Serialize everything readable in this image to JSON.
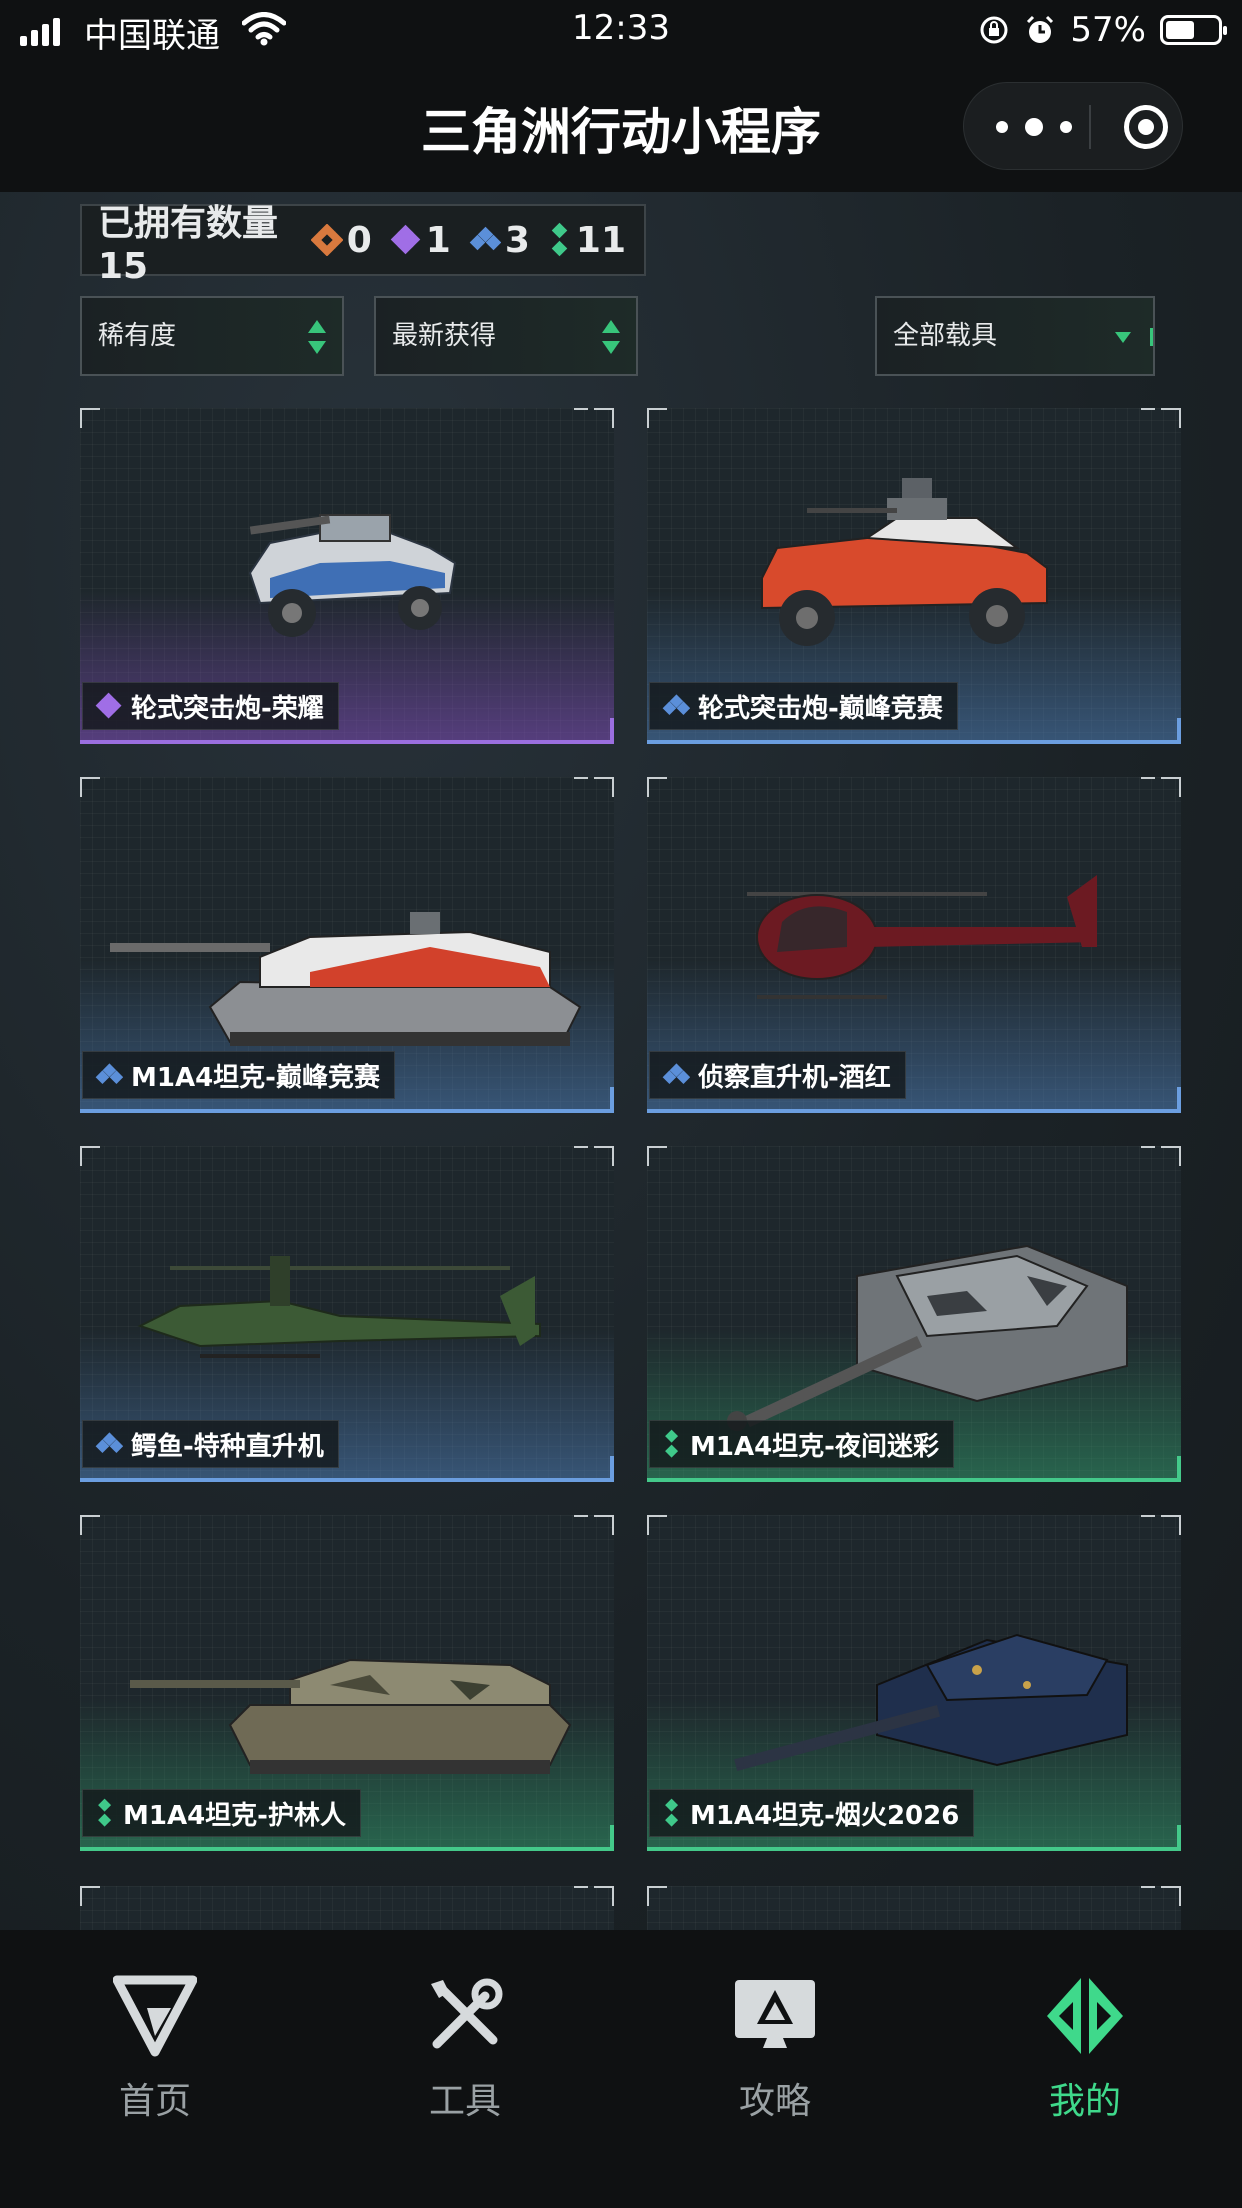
{
  "status_bar": {
    "carrier": "中国联通",
    "time": "12:33",
    "battery_percent": "57%",
    "battery_level": 0.57
  },
  "header": {
    "title": "三角洲行动小程序",
    "more_icon": "more-dots-icon",
    "close_icon": "target-close-icon"
  },
  "summary": {
    "owned_label": "已拥有数量15",
    "rarities": [
      {
        "icon": "orange-diamond-icon",
        "color": "#d9793e",
        "count": "0"
      },
      {
        "icon": "purple-diamond-icon",
        "color": "#a06ee6",
        "count": "1"
      },
      {
        "icon": "blue-diamond-icon",
        "color": "#5b8fd9",
        "count": "3"
      },
      {
        "icon": "green-diamond-icon",
        "color": "#3fc98a",
        "count": "11"
      }
    ]
  },
  "filters": {
    "rarity": "稀有度",
    "sort": "最新获得",
    "vehicle_type": "全部载具"
  },
  "cards": [
    {
      "name": "轮式突击炮-荣耀",
      "rarity": "purple",
      "vehicle": "wheeled-assault-gun"
    },
    {
      "name": "轮式突击炮-巅峰竞赛",
      "rarity": "blue",
      "vehicle": "wheeled-assault-gun-red"
    },
    {
      "name": "M1A4坦克-巅峰竞赛",
      "rarity": "blue",
      "vehicle": "tank-red"
    },
    {
      "name": "侦察直升机-酒红",
      "rarity": "blue",
      "vehicle": "scout-helicopter"
    },
    {
      "name": "鳄鱼-特种直升机",
      "rarity": "blue",
      "vehicle": "attack-helicopter"
    },
    {
      "name": "M1A4坦克-夜间迷彩",
      "rarity": "green",
      "vehicle": "tank-camo-grey"
    },
    {
      "name": "M1A4坦克-护林人",
      "rarity": "green",
      "vehicle": "tank-forest"
    },
    {
      "name": "M1A4坦克-烟火2026",
      "rarity": "green",
      "vehicle": "tank-navy"
    }
  ],
  "tabs": [
    {
      "label": "首页",
      "icon": "home-logo-icon",
      "active": false
    },
    {
      "label": "工具",
      "icon": "tools-icon",
      "active": false
    },
    {
      "label": "攻略",
      "icon": "guide-monitor-icon",
      "active": false
    },
    {
      "label": "我的",
      "icon": "profile-logo-icon",
      "active": true
    }
  ],
  "colors": {
    "accent_green": "#3fd98b",
    "purple_rarity": "#9b6fe0",
    "blue_rarity": "#6b9ee0",
    "green_rarity": "#44c98a"
  }
}
